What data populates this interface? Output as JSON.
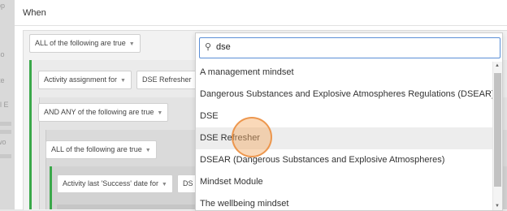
{
  "sidebar_fragments": [
    "op",
    "so",
    "ite",
    "ill E",
    "wo"
  ],
  "section_title": "When",
  "conditions": {
    "top_group": "ALL of the following are true",
    "activity_assignment": "Activity assignment for",
    "activity_value": "DSE Refresher",
    "any_group": "AND ANY of the following are true",
    "all_group_inner": "ALL of the following are true",
    "activity_last": "Activity last 'Success' date for",
    "activity_last_value": "DS"
  },
  "dropdown": {
    "search_value": "dse",
    "options": [
      "A management mindset",
      "Dangerous Substances and Explosive Atmospheres Regulations (DSEAR)",
      "DSE",
      "DSE Refresher",
      "DSEAR (Dangerous Substances and Explosive Atmospheres)",
      "Mindset Module",
      "The wellbeing mindset"
    ],
    "highlighted_index": 3
  }
}
